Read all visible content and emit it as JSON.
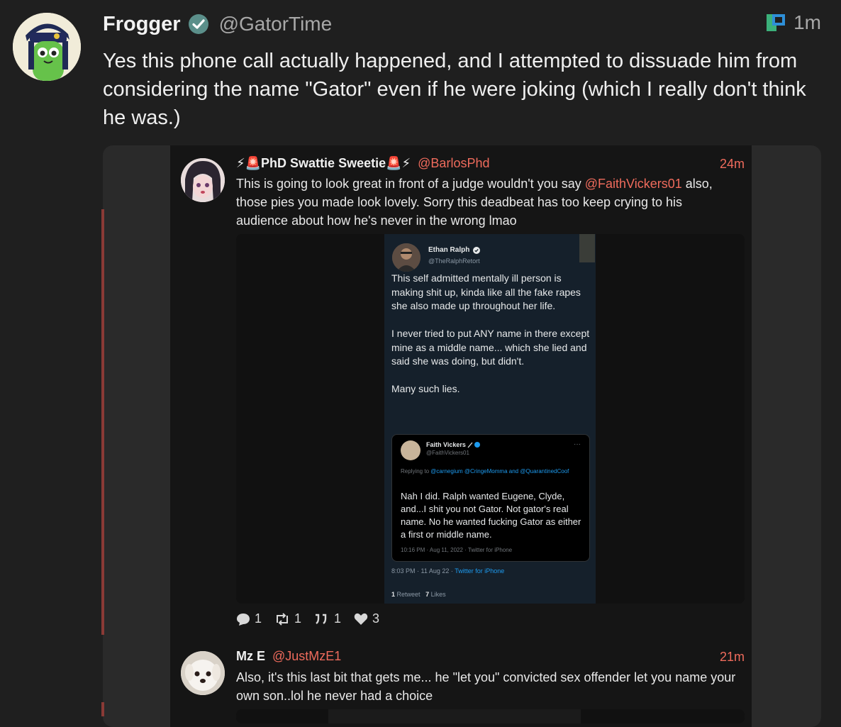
{
  "post": {
    "display_name": "Frogger",
    "handle": "@GatorTime",
    "time": "1m",
    "text": "Yes this phone call actually happened, and I attempted to dissuade him from considering the name \"Gator\" even if he were joking (which I really don't think he was.)"
  },
  "reply1": {
    "display_name": "⚡🚨PhD Swattie Sweetie🚨⚡",
    "handle": "@BarlosPhd",
    "time": "24m",
    "text_a": "This is going to look great in front of a judge wouldn't you say ",
    "mention": "@FaithVickers01",
    "text_b": " also, those pies you made look lovely. Sorry this deadbeat has too keep crying to his audience about how he's never in the wrong lmao",
    "actions": {
      "replies": "1",
      "reposts": "1",
      "quotes": "1",
      "likes": "3"
    }
  },
  "embedded_tweet": {
    "name": "Ethan Ralph",
    "handle": "@TheRalphRetort",
    "body": "This self admitted mentally ill person is making shit up, kinda like all the fake rapes she also made up throughout her life.\n\nI never tried to put ANY name in there except mine as a middle name... which she lied and said she was doing, but didn't.\n\nMany such lies.",
    "timestamp": "8:03 PM · 11 Aug 22 · ",
    "app": "Twitter for iPhone",
    "retweets_count": "1",
    "retweets_label": "Retweet",
    "likes_count": "7",
    "likes_label": "Likes",
    "quote": {
      "name": "Faith Vickers",
      "handle": "@FaithVickers01",
      "more": "···",
      "replying_prefix": "Replying to ",
      "replying_to": "@carnegium @CringeMomma and @QuarantinedCoof",
      "body": "Nah I did. Ralph wanted Eugene, Clyde, and...I shit you not Gator. Not gator's real name. No he wanted fucking Gator as either a first or middle name.",
      "meta": "10:16 PM · Aug 11, 2022 · Twitter for iPhone"
    }
  },
  "reply2": {
    "display_name": "Mz E",
    "handle": "@JustMzE1",
    "time": "21m",
    "text": "Also, it's this last bit that gets me... he \"let you\" convicted sex offender let you name your own son..lol he never had a choice"
  },
  "colors": {
    "accent": "#ef6b5c",
    "thread_line": "#8a3a36",
    "verified": "#5b8f8a",
    "twitter_blue": "#1d9bf0"
  }
}
